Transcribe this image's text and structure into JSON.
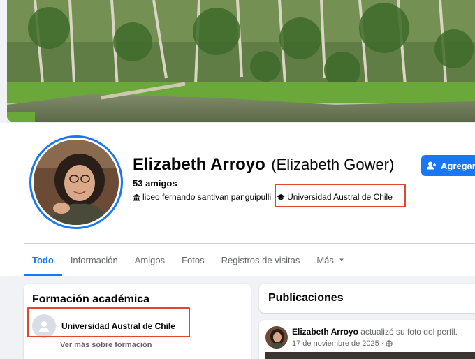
{
  "profile": {
    "name": "Elizabeth Arroyo",
    "alt_name": "(Elizabeth Gower)",
    "friends": "53 amigos",
    "school_1": "liceo fernando santivan panguipulli",
    "school_2": "Universidad Austral de Chile",
    "add_button": "Agregar a"
  },
  "tabs": [
    "Todo",
    "Información",
    "Amigos",
    "Fotos",
    "Registros de visitas",
    "Más"
  ],
  "education": {
    "title": "Formación académica",
    "school": "Universidad Austral de Chile",
    "more": "Ver más sobre formación"
  },
  "posts": {
    "title": "Publicaciones",
    "author": "Elizabeth Arroyo",
    "action": "actualizó su foto del perfil.",
    "date": "17 de noviembre de 2025",
    "separator": "·"
  },
  "colors": {
    "accent": "#1877f2",
    "highlight": "#e0482d"
  },
  "icons": [
    "school-icon",
    "graduation-cap-icon",
    "add-friend-icon",
    "chevron-down-icon",
    "globe-icon"
  ]
}
